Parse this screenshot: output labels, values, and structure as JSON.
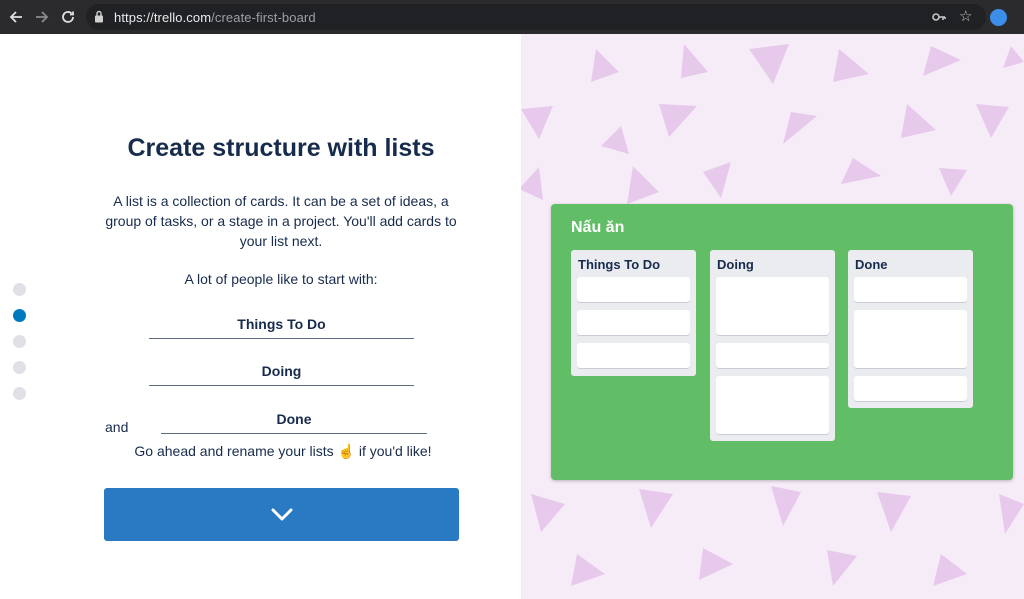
{
  "browser": {
    "url_domain": "https://trello.com",
    "url_path": "/create-first-board"
  },
  "onboarding": {
    "title": "Create structure with lists",
    "description": "A list is a collection of cards. It can be a set of ideas, a group of tasks, or a stage in a project. You'll add cards to your list next.",
    "hint": "A lot of people like to start with:",
    "fields": [
      "Things To Do",
      "Doing",
      "Done"
    ],
    "and_label": "and",
    "rename_text": "Go ahead and rename your lists ☝️ if you'd like!",
    "step_current": 2,
    "step_total": 5
  },
  "board": {
    "title": "Nấu ăn",
    "color": "#61bd66",
    "lists": [
      {
        "name": "Things To Do"
      },
      {
        "name": "Doing"
      },
      {
        "name": "Done"
      }
    ]
  },
  "colors": {
    "accent": "#2a79c3",
    "text": "#172b4d",
    "pattern_bg": "#f6ecf8"
  }
}
